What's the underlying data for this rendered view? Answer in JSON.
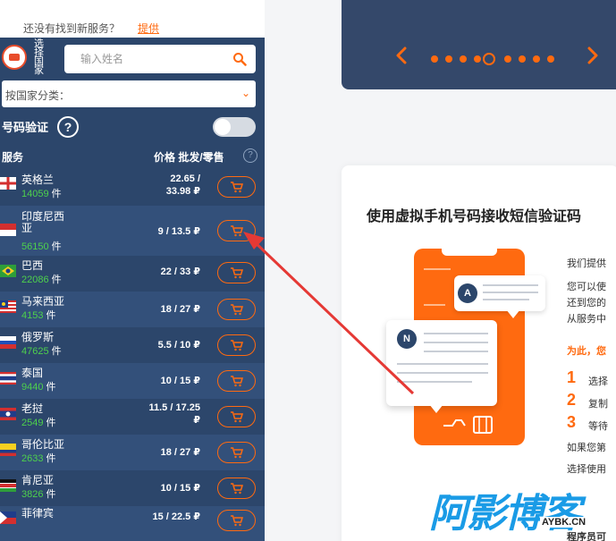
{
  "top_notice": {
    "question": "还没有找到新服务？",
    "link": "提供"
  },
  "country_selector": {
    "label": "选择国家"
  },
  "search": {
    "placeholder": "输入姓名"
  },
  "category": {
    "placeholder": "按国家分类："
  },
  "verify": {
    "label": "号码验证",
    "help": "?",
    "toggle_on": false
  },
  "table_header": {
    "service": "服务",
    "price": "价格 批发/零售",
    "help": "?"
  },
  "count_unit": "件",
  "rows": [
    {
      "name": "英格兰",
      "count": "14059",
      "price_line1": "22.65 /",
      "price_line2": "33.98 ₽",
      "flag": "england-flag"
    },
    {
      "name": "印度尼西亚",
      "count": "56150",
      "price_line1": "9 / 13.5 ₽",
      "price_line2": "",
      "flag": "indonesia-flag"
    },
    {
      "name": "巴西",
      "count": "22086",
      "price_line1": "22 / 33 ₽",
      "price_line2": "",
      "flag": "brazil-flag"
    },
    {
      "name": "马来西亚",
      "count": "4153",
      "price_line1": "18 / 27 ₽",
      "price_line2": "",
      "flag": "malaysia-flag"
    },
    {
      "name": "俄罗斯",
      "count": "47625",
      "price_line1": "5.5 / 10 ₽",
      "price_line2": "",
      "flag": "russia-flag"
    },
    {
      "name": "泰国",
      "count": "9440",
      "price_line1": "10 / 15 ₽",
      "price_line2": "",
      "flag": "thailand-flag"
    },
    {
      "name": "老挝",
      "count": "2549",
      "price_line1": "11.5 / 17.25",
      "price_line2": "₽",
      "flag": "laos-flag"
    },
    {
      "name": "哥伦比亚",
      "count": "2633",
      "price_line1": "18 / 27 ₽",
      "price_line2": "",
      "flag": "colombia-flag"
    },
    {
      "name": "肯尼亚",
      "count": "3826",
      "price_line1": "10 / 15 ₽",
      "price_line2": "",
      "flag": "kenya-flag"
    },
    {
      "name": "菲律宾",
      "count": "",
      "price_line1": "15 / 22.5 ₽",
      "price_line2": "",
      "flag": "philippines-flag"
    }
  ],
  "card": {
    "title": "使用虚拟手机号码接收短信验证码",
    "paragraph": [
      "我们提供",
      "您可以使",
      "还到您的",
      "从服务中"
    ],
    "highlight": "为此，您",
    "steps": [
      {
        "num": "1",
        "text": "选择"
      },
      {
        "num": "2",
        "text": "复制"
      },
      {
        "num": "3",
        "text": "等待"
      }
    ],
    "after": [
      "如果您第",
      "选择使用"
    ],
    "bottom": "程序员可"
  },
  "bubbles": {
    "a": "A",
    "n": "N"
  },
  "watermark": {
    "main": "阿影博客",
    "url": "AYBK.CN"
  },
  "colors": {
    "accent": "#ff6a10",
    "panel": "#2c466b",
    "count_green": "#4ed14c",
    "arrow": "#e53935"
  }
}
